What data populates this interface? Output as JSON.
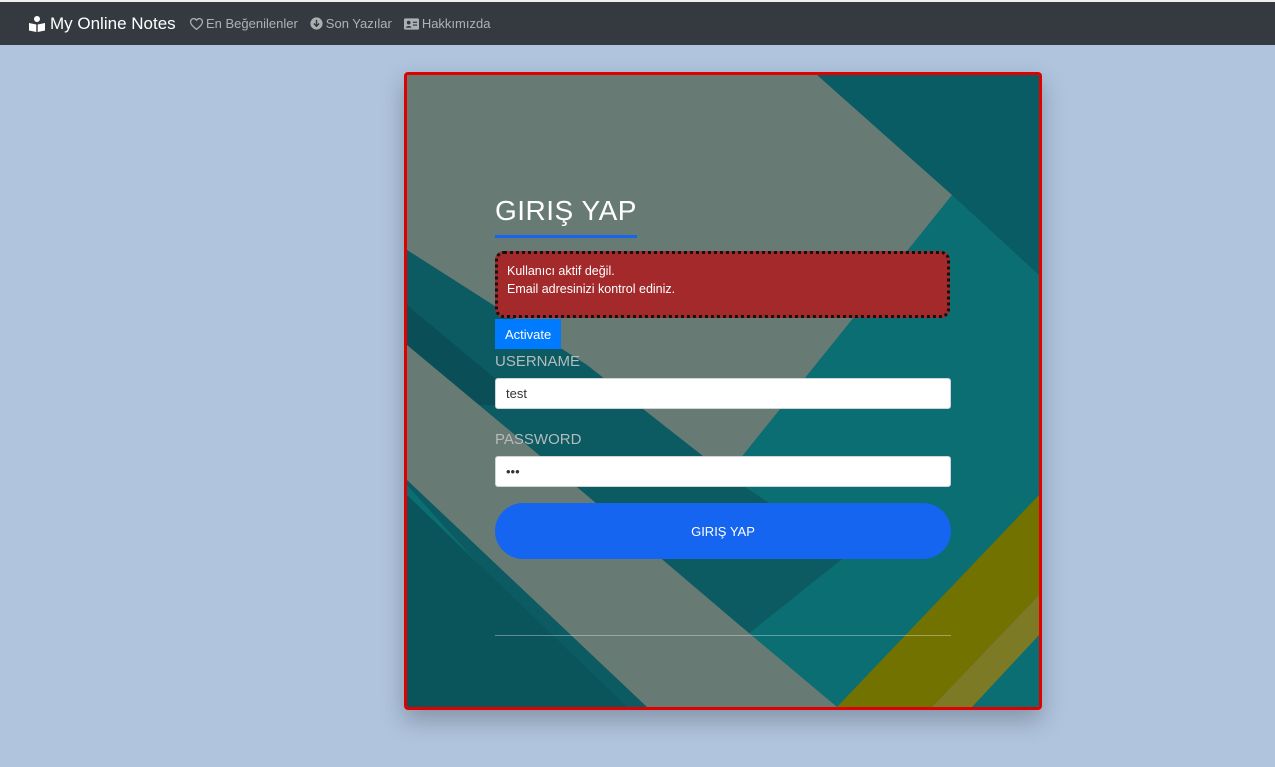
{
  "navbar": {
    "brand": "My Online Notes",
    "items": [
      {
        "label": "En Beğenilenler",
        "icon": "heart-icon"
      },
      {
        "label": "Son Yazılar",
        "icon": "arrow-down-circle-icon"
      },
      {
        "label": "Hakkımızda",
        "icon": "id-card-icon"
      }
    ]
  },
  "login": {
    "title": "GIRIŞ YAP",
    "alert": {
      "line1": "Kullanıcı aktif değil.",
      "line2": "Email adresinizi kontrol ediniz."
    },
    "activate_label": "Activate",
    "username_label": "USERNAME",
    "username_value": "test",
    "password_label": "PASSWORD",
    "password_value": "abc",
    "submit_label": "GIRIŞ YAP"
  },
  "colors": {
    "page_bg": "#b0c4de",
    "navbar_bg": "#343a40",
    "accent_blue": "#1565f0",
    "alert_bg": "#a3292b",
    "card_border": "#e00000"
  }
}
